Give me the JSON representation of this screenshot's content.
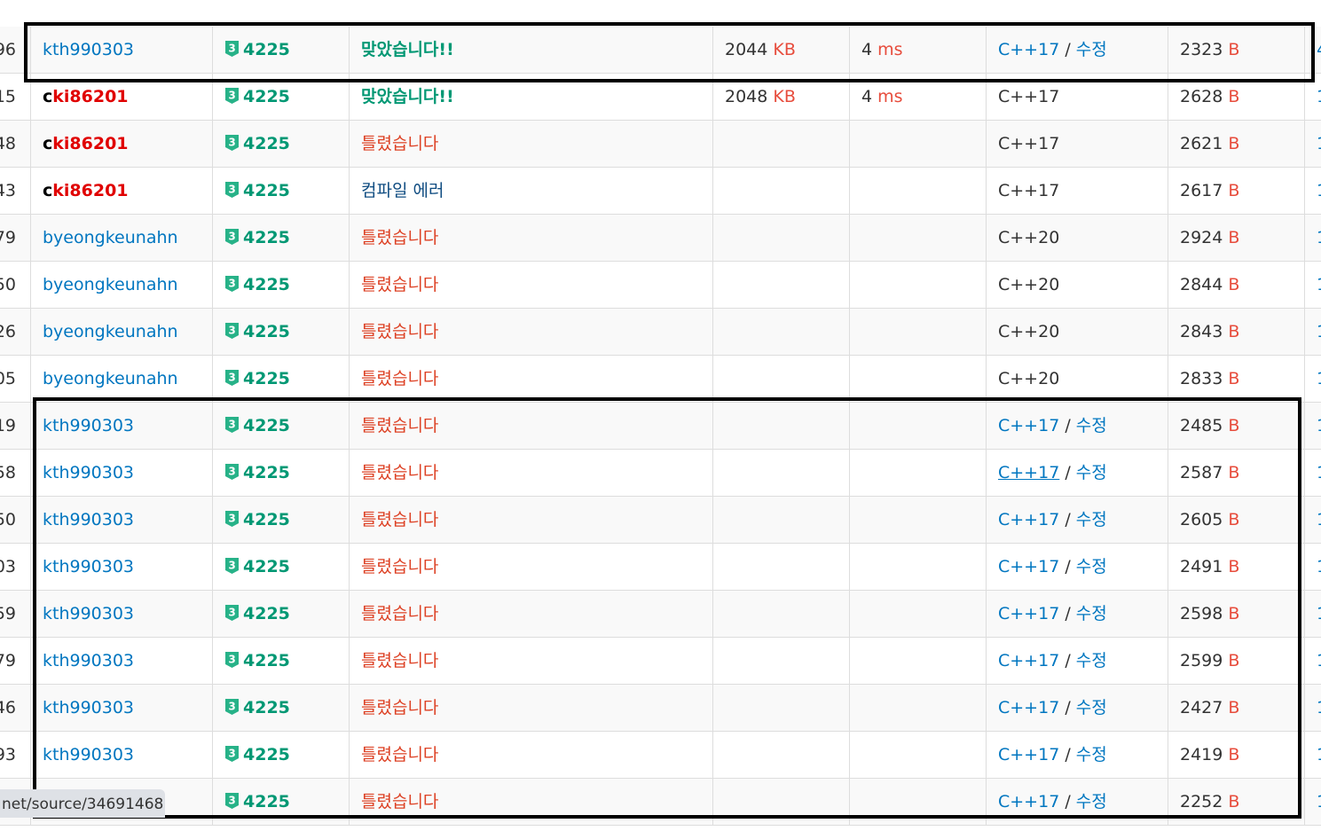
{
  "colors": {
    "link": "#0076c0",
    "accepted": "#009874",
    "wrong": "#dd4124",
    "compile_error": "#0f4c81",
    "unit_red": "#e74c3c",
    "row_stripe": "#f9f9f9",
    "highlight_box": "#000000"
  },
  "tier_icon": "silver-3-tier-icon",
  "tier_label": "3",
  "rows": [
    {
      "id": "96",
      "user": "kth990303",
      "user_style": "link",
      "problem": "4225",
      "result": "맞았습니다!!",
      "result_type": "ac",
      "memory": "2044",
      "memory_unit": "KB",
      "time": "4",
      "time_unit": "ms",
      "lang": "C++17",
      "lang_link": true,
      "edit": "수정",
      "length": "2323",
      "length_unit": "B",
      "sub": "4"
    },
    {
      "id": "15",
      "user_first": "c",
      "user_rest": "ki86201",
      "user_style": "red",
      "problem": "4225",
      "result": "맞았습니다!!",
      "result_type": "ac",
      "memory": "2048",
      "memory_unit": "KB",
      "time": "4",
      "time_unit": "ms",
      "lang": "C++17",
      "lang_link": false,
      "length": "2628",
      "length_unit": "B",
      "sub": "1"
    },
    {
      "id": "48",
      "user_first": "c",
      "user_rest": "ki86201",
      "user_style": "red",
      "problem": "4225",
      "result": "틀렸습니다",
      "result_type": "wa",
      "lang": "C++17",
      "lang_link": false,
      "length": "2621",
      "length_unit": "B",
      "sub": "1"
    },
    {
      "id": "43",
      "user_first": "c",
      "user_rest": "ki86201",
      "user_style": "red",
      "problem": "4225",
      "result": "컴파일 에러",
      "result_type": "ce",
      "lang": "C++17",
      "lang_link": false,
      "length": "2617",
      "length_unit": "B",
      "sub": "1"
    },
    {
      "id": "79",
      "user": "byeongkeunahn",
      "user_style": "link",
      "problem": "4225",
      "result": "틀렸습니다",
      "result_type": "wa",
      "lang": "C++20",
      "lang_link": false,
      "length": "2924",
      "length_unit": "B",
      "sub": "1"
    },
    {
      "id": "50",
      "user": "byeongkeunahn",
      "user_style": "link",
      "problem": "4225",
      "result": "틀렸습니다",
      "result_type": "wa",
      "lang": "C++20",
      "lang_link": false,
      "length": "2844",
      "length_unit": "B",
      "sub": "1"
    },
    {
      "id": "26",
      "user": "byeongkeunahn",
      "user_style": "link",
      "problem": "4225",
      "result": "틀렸습니다",
      "result_type": "wa",
      "lang": "C++20",
      "lang_link": false,
      "length": "2843",
      "length_unit": "B",
      "sub": "1"
    },
    {
      "id": "05",
      "user": "byeongkeunahn",
      "user_style": "link",
      "problem": "4225",
      "result": "틀렸습니다",
      "result_type": "wa",
      "lang": "C++20",
      "lang_link": false,
      "length": "2833",
      "length_unit": "B",
      "sub": "1"
    },
    {
      "id": "19",
      "user": "kth990303",
      "user_style": "link",
      "problem": "4225",
      "result": "틀렸습니다",
      "result_type": "wa",
      "lang": "C++17",
      "lang_link": true,
      "edit": "수정",
      "length": "2485",
      "length_unit": "B",
      "sub": "1"
    },
    {
      "id": "58",
      "user": "kth990303",
      "user_style": "link",
      "problem": "4225",
      "result": "틀렸습니다",
      "result_type": "wa",
      "lang": "C++17",
      "lang_link": true,
      "lang_underline": true,
      "edit": "수정",
      "length": "2587",
      "length_unit": "B",
      "sub": "1"
    },
    {
      "id": "50",
      "user": "kth990303",
      "user_style": "link",
      "problem": "4225",
      "result": "틀렸습니다",
      "result_type": "wa",
      "lang": "C++17",
      "lang_link": true,
      "edit": "수정",
      "length": "2605",
      "length_unit": "B",
      "sub": "1"
    },
    {
      "id": "03",
      "user": "kth990303",
      "user_style": "link",
      "problem": "4225",
      "result": "틀렸습니다",
      "result_type": "wa",
      "lang": "C++17",
      "lang_link": true,
      "edit": "수정",
      "length": "2491",
      "length_unit": "B",
      "sub": "1"
    },
    {
      "id": "59",
      "user": "kth990303",
      "user_style": "link",
      "problem": "4225",
      "result": "틀렸습니다",
      "result_type": "wa",
      "lang": "C++17",
      "lang_link": true,
      "edit": "수정",
      "length": "2598",
      "length_unit": "B",
      "sub": "1"
    },
    {
      "id": "79",
      "user": "kth990303",
      "user_style": "link",
      "problem": "4225",
      "result": "틀렸습니다",
      "result_type": "wa",
      "lang": "C++17",
      "lang_link": true,
      "edit": "수정",
      "length": "2599",
      "length_unit": "B",
      "sub": "1"
    },
    {
      "id": "46",
      "user": "kth990303",
      "user_style": "link",
      "problem": "4225",
      "result": "틀렸습니다",
      "result_type": "wa",
      "lang": "C++17",
      "lang_link": true,
      "edit": "수정",
      "length": "2427",
      "length_unit": "B",
      "sub": "1"
    },
    {
      "id": "93",
      "user": "kth990303",
      "user_style": "link",
      "problem": "4225",
      "result": "틀렸습니다",
      "result_type": "wa",
      "lang": "C++17",
      "lang_link": true,
      "edit": "수정",
      "length": "2419",
      "length_unit": "B",
      "sub": "1"
    },
    {
      "id": "",
      "user": "",
      "user_style": "link",
      "problem": "4225",
      "result": "틀렸습니다",
      "result_type": "wa",
      "lang": "C++17",
      "lang_link": true,
      "edit": "수정",
      "length": "2252",
      "length_unit": "B",
      "sub": "1"
    }
  ],
  "lang_separator": " / ",
  "status_bar": {
    "url": "net/source/34691468"
  }
}
